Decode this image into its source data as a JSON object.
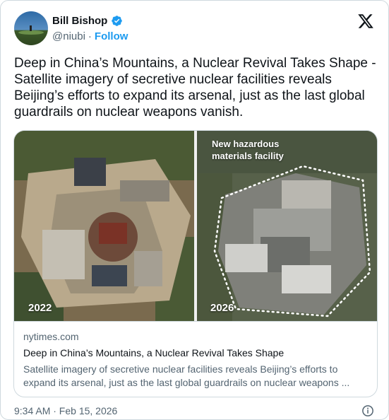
{
  "author": {
    "name": "Bill Bishop",
    "handle": "@niubi",
    "separator": "·",
    "follow_label": "Follow",
    "verified_color": "#1d9bf0"
  },
  "tweet": {
    "text": "Deep in China’s Mountains, a Nuclear Revival Takes Shape - Satellite imagery of secretive nuclear facilities reveals Beijing’s efforts to expand its arsenal, just as the last global guardrails on nuclear weapons vanish."
  },
  "media": {
    "left_year": "2022",
    "right_year": "2026",
    "annotation": "New hazardous materials facility"
  },
  "link_card": {
    "domain": "nytimes.com",
    "title": "Deep in China’s Mountains, a Nuclear Revival Takes Shape",
    "description": "Satellite imagery of secretive nuclear facilities reveals Beijing’s efforts to expand its arsenal, just as the last global guardrails on nuclear weapons ..."
  },
  "footer": {
    "timestamp": "9:34 AM · Feb 15, 2026"
  },
  "icons": {
    "brand": "x-logo-icon",
    "verified": "verified-badge-icon",
    "info": "info-icon"
  }
}
